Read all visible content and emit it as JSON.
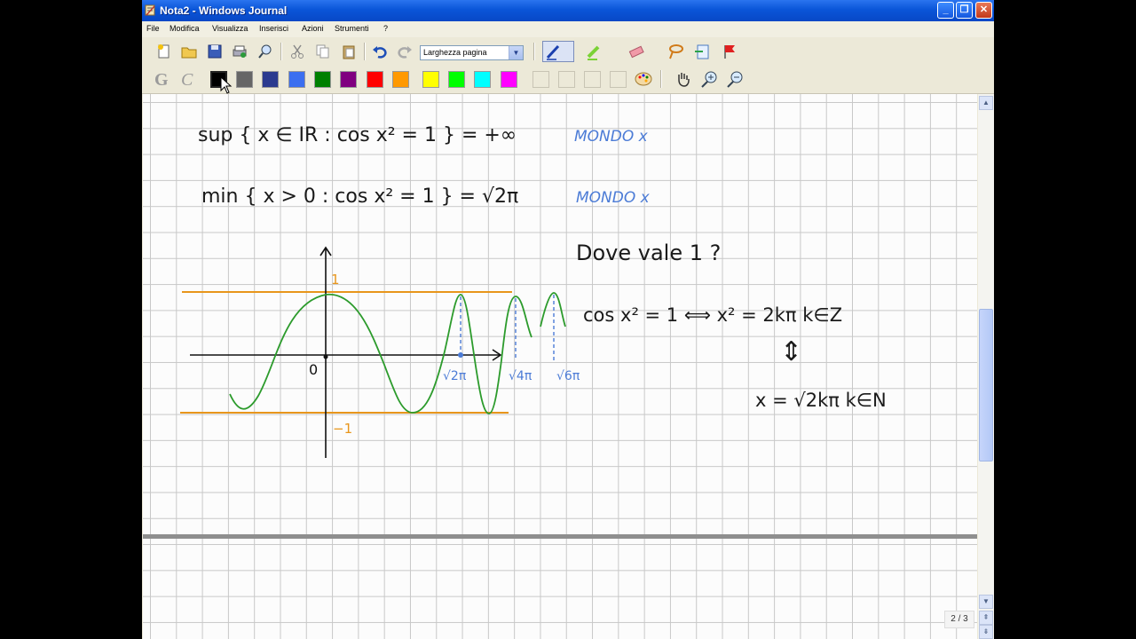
{
  "window": {
    "title": "Nota2 - Windows Journal"
  },
  "menu": [
    "File",
    "Modifica",
    "Visualizza",
    "Inserisci",
    "Azioni",
    "Strumenti",
    "?"
  ],
  "toolbar": {
    "zoom_value": "Larghezza pagina"
  },
  "palette": {
    "colors": [
      "#000000",
      "#666666",
      "#2b3a8f",
      "#3b6ff0",
      "#008000",
      "#800080",
      "#ff0000",
      "#ff9900",
      "#ffff00",
      "#00ff00",
      "#00ffff",
      "#ff00ff"
    ],
    "selected": "#000000"
  },
  "note": {
    "line1": {
      "expr": "sup { x ∈ IR : cos x² = 1 } = +∞",
      "tag": "MONDO x"
    },
    "line2": {
      "expr": "min { x > 0 : cos x² = 1 } = √2π",
      "tag": "MONDO x"
    },
    "question": "Dove vale 1 ?",
    "equivalence": "cos x² = 1 ⟺ x² = 2kπ   k∈Z",
    "iff_arrow": "⇕",
    "solution": "x = √2kπ   k∈N",
    "graph": {
      "upper_label": "1",
      "lower_label": "−1",
      "origin_label": "0",
      "root_labels": [
        "√2π",
        "√4π",
        "√6π"
      ]
    }
  },
  "status": {
    "page_indicator": "2 / 3"
  }
}
